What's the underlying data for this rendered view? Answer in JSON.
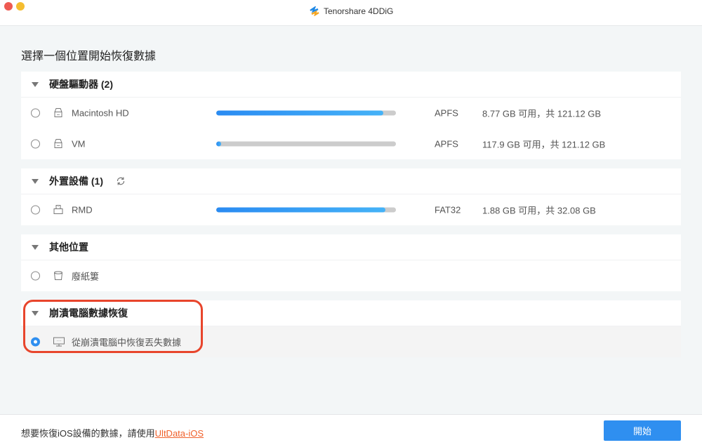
{
  "window": {
    "app_name": "Tenorshare 4DDiG"
  },
  "heading": "選擇一個位置開始恢復數據",
  "sections": [
    {
      "title": "硬盤驅動器 (2)",
      "items": [
        {
          "name": "Macintosh HD",
          "used_fraction": 0.928,
          "fs": "APFS",
          "size": "8.77 GB 可用，共 121.12 GB"
        },
        {
          "name": "VM",
          "used_fraction": 0.027,
          "fs": "APFS",
          "size": "117.9 GB 可用，共 121.12 GB"
        }
      ]
    },
    {
      "title": "外置設備 (1)",
      "items": [
        {
          "name": "RMD",
          "used_fraction": 0.941,
          "fs": "FAT32",
          "size": "1.88 GB 可用，共 32.08 GB"
        }
      ]
    },
    {
      "title": "其他位置",
      "items": [
        {
          "name": "廢紙簍"
        }
      ]
    },
    {
      "title": "崩潰電腦數據恢復",
      "items": [
        {
          "name": "從崩潰電腦中恢復丟失數據",
          "selected": true
        }
      ]
    }
  ],
  "footer": {
    "text": "想要恢復iOS設備的數據，請使用",
    "link": "UltData-iOS",
    "start_label": "開始"
  },
  "colors": {
    "accent": "#2f8ff0",
    "link": "#f0612c",
    "highlight": "#e8452c"
  }
}
